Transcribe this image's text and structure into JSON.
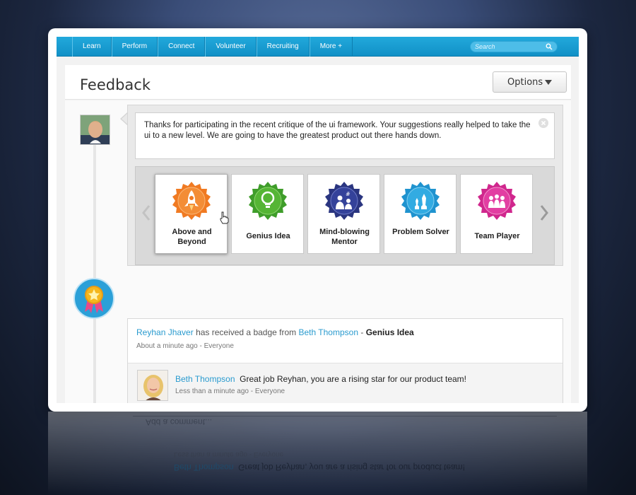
{
  "nav": {
    "items": [
      "Learn",
      "Perform",
      "Connect",
      "Volunteer",
      "Recruiting",
      "More +"
    ],
    "search_placeholder": "Search"
  },
  "header": {
    "title": "Feedback",
    "options_label": "Options"
  },
  "post": {
    "message": "Thanks for participating in the recent critique of the ui framework. Your suggestions really helped to take the ui to a new level. We are going to have the greatest product out there hands down.",
    "badges": [
      {
        "label": "Above and Beyond",
        "icon": "rocket-icon",
        "color": "#f07a22",
        "selected": true
      },
      {
        "label": "Genius Idea",
        "icon": "lightbulb-icon",
        "color": "#4fb233",
        "selected": false
      },
      {
        "label": "Mind-blowing Mentor",
        "icon": "mentor-icon",
        "color": "#2f3e8f",
        "selected": false
      },
      {
        "label": "Problem Solver",
        "icon": "chess-icon",
        "color": "#2ba6dc",
        "selected": false
      },
      {
        "label": "Team Player",
        "icon": "team-icon",
        "color": "#e0359b",
        "selected": false
      }
    ]
  },
  "activity": {
    "recipient": "Reyhan Jhaver",
    "verb": "has received a badge from",
    "sender": "Beth Thompson",
    "separator": "-",
    "badge_name": "Genius Idea",
    "time": "About a minute ago",
    "meta_sep": "-",
    "audience": "Everyone",
    "comment": {
      "author": "Beth Thompson",
      "text": "Great job Reyhan, you are a rising star for our product team!",
      "time": "Less than a minute ago",
      "meta_sep": "-",
      "audience": "Everyone"
    },
    "add_comment_placeholder": "Add a comment..."
  },
  "reflection": {
    "comment_author": "Beth Thompson",
    "comment_text": "Great job Reyhan, you are a rising star for our product team!",
    "comment_time": "Less than a minute ago - Everyone",
    "add_comment_placeholder": "Add a comment..."
  }
}
